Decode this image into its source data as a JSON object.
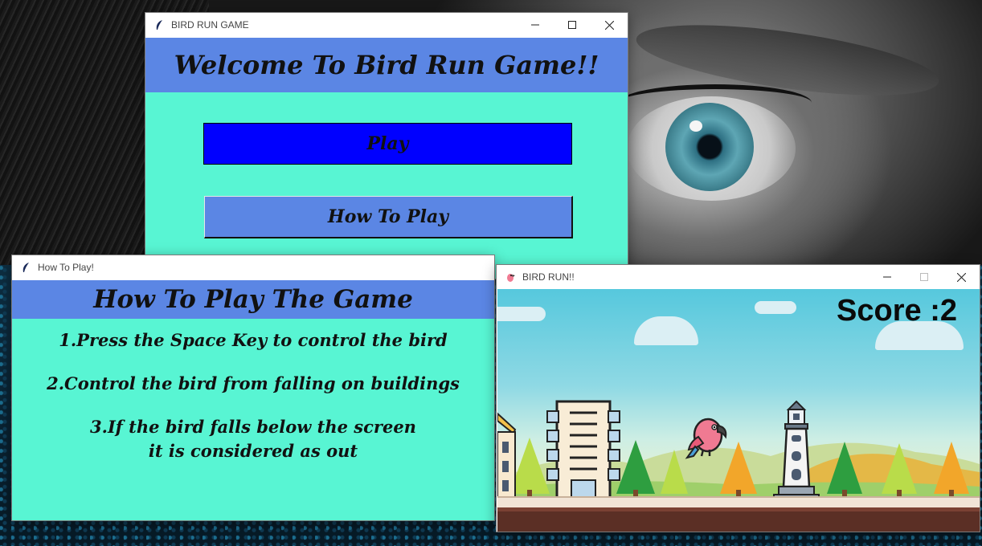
{
  "main_window": {
    "title": "BIRD RUN GAME",
    "heading": "Welcome To Bird Run Game!!",
    "play_label": "Play",
    "how_to_play_label": "How To Play"
  },
  "howto_window": {
    "title": "How To Play!",
    "heading": "How To Play The Game",
    "instructions": [
      "1.Press the Space Key to control the bird",
      "2.Control the bird from falling on buildings",
      "3.If the bird falls below the screen",
      "it is considered as out"
    ]
  },
  "game_window": {
    "title": "BIRD RUN!!",
    "score_text": "Score :2"
  },
  "colors": {
    "header_blue": "#5b86e4",
    "body_aqua": "#58f5d3",
    "play_blue": "#0000ff"
  },
  "icons": {
    "tk_feather": "feather-icon",
    "parrot": "parrot-icon",
    "minimize": "minimize-icon",
    "maximize": "maximize-icon",
    "close": "close-icon"
  }
}
